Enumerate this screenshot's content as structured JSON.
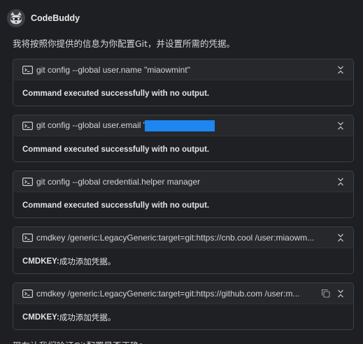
{
  "header": {
    "name": "CodeBuddy",
    "avatar_icon": "raccoon-avatar-icon"
  },
  "intro_text": "我将按照你提供的信息为你配置Git，并设置所需的凭据。",
  "cards": [
    {
      "command": "git config --global user.name \"miaowmint\"",
      "result": "Command executed successfully with no output."
    },
    {
      "command": "git config --global user.email \"",
      "redacted": true,
      "result": "Command executed successfully with no output."
    },
    {
      "command": "git config --global credential.helper manager",
      "result": "Command executed successfully with no output."
    },
    {
      "command": "cmdkey /generic:LegacyGeneric:target=git:https://cnb.cool /user:miaowm...",
      "result_label": "CMDKEY:",
      "result_text": " 成功添加凭据。"
    },
    {
      "command": "cmdkey /generic:LegacyGeneric:target=git:https://github.com /user:m...",
      "result_label": "CMDKEY:",
      "result_text": " 成功添加凭据。",
      "has_copy": true
    }
  ],
  "trailing_text": "现在让我们验证Git配置是否正确：",
  "colors": {
    "background": "#1e1f22",
    "card": "#25272b",
    "border": "#3d4047",
    "redaction": "#1d86f0"
  }
}
